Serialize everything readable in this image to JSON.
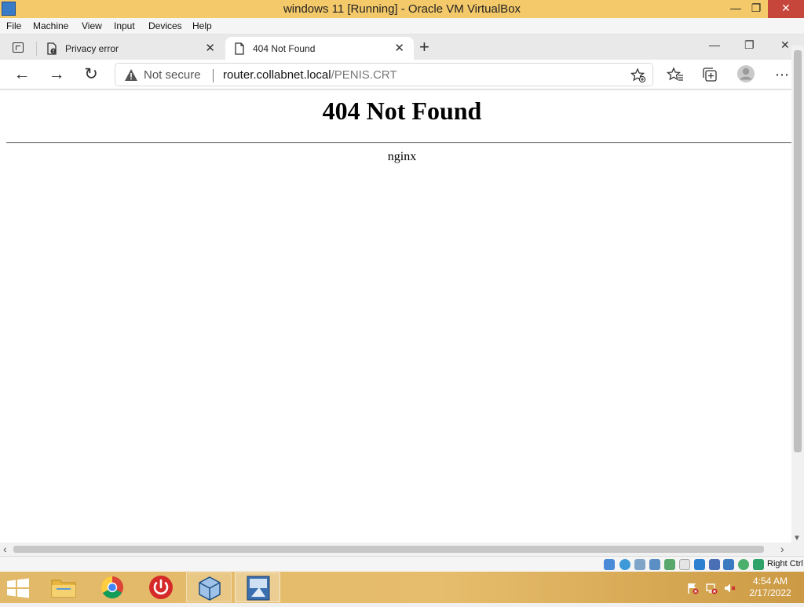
{
  "vbox": {
    "title": "windows 11 [Running] - Oracle VM VirtualBox",
    "menu": [
      "File",
      "Machine",
      "View",
      "Input",
      "Devices",
      "Help"
    ],
    "host_key": "Right Ctrl"
  },
  "browser": {
    "tabs": [
      {
        "label": "Privacy error",
        "active": false
      },
      {
        "label": "404 Not Found",
        "active": true
      }
    ],
    "address": {
      "security_label": "Not secure",
      "url_host": "router.collabnet.local",
      "url_path": "/PENIS.CRT"
    }
  },
  "page": {
    "heading": "404 Not Found",
    "server": "nginx"
  },
  "taskbar": {
    "apps": [
      "file-explorer",
      "chrome",
      "power-app",
      "virtualbox",
      "windows-11-vm"
    ],
    "time": "4:54 AM",
    "date": "2/17/2022"
  },
  "colors": {
    "vbox_title_bg": "#f4c96a",
    "taskbar_bg": "#e2b968",
    "tab_strip_bg": "#e9e9e9",
    "close_red": "#c7463b"
  }
}
